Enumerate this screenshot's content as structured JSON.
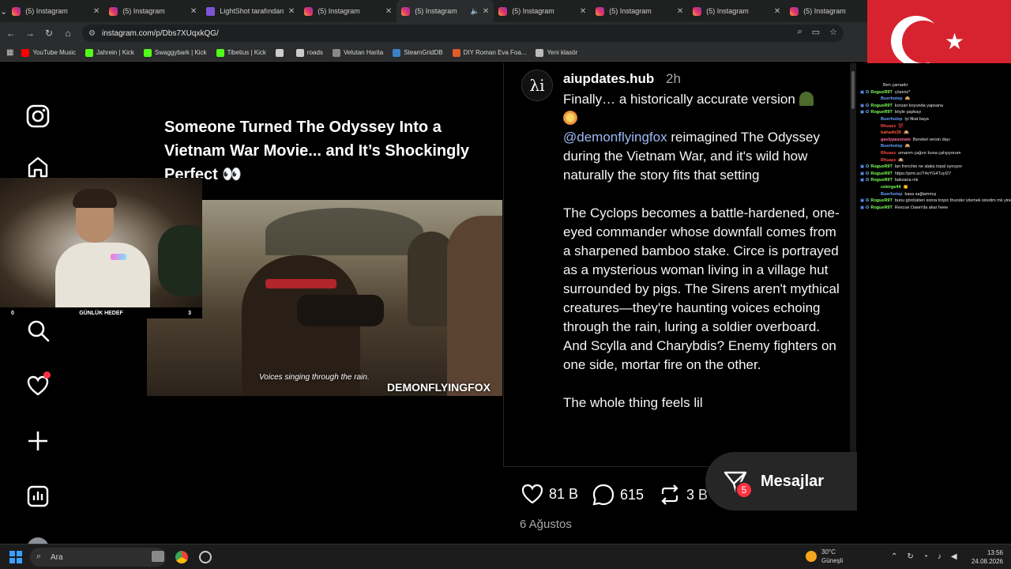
{
  "browser": {
    "tabs": [
      {
        "label": "(5) Instagram",
        "active": false
      },
      {
        "label": "(5) Instagram",
        "active": false
      },
      {
        "label": "LightShot tarafından",
        "active": false
      },
      {
        "label": "(5) Instagram",
        "active": false
      },
      {
        "label": "(5) Instagram",
        "active": true
      },
      {
        "label": "(5) Instagram",
        "active": false
      },
      {
        "label": "(5) Instagram",
        "active": false
      },
      {
        "label": "(5) Instagram",
        "active": false
      },
      {
        "label": "(5) Instagram",
        "active": false
      }
    ],
    "url": "instagram.com/p/Dbs7XUqxkQG/",
    "bookmarks": [
      {
        "label": "YouTube Music",
        "color": "#ff0000"
      },
      {
        "label": "Jahrein | Kick",
        "color": "#53fc18"
      },
      {
        "label": "Swaggybark | Kick",
        "color": "#53fc18"
      },
      {
        "label": "Tibetius | Kick",
        "color": "#53fc18"
      },
      {
        "label": "",
        "color": "#cccccc"
      },
      {
        "label": "roads",
        "color": "#cccccc"
      },
      {
        "label": "Velutan Harita",
        "color": "#888888"
      },
      {
        "label": "SteamGridDB",
        "color": "#3b82c4"
      },
      {
        "label": "DIY Roman Eva Foa...",
        "color": "#e05a2b"
      },
      {
        "label": "Yeni klasör",
        "color": "#bbbbbb"
      }
    ]
  },
  "rail": {
    "icons": [
      "instagram-logo-icon",
      "home-icon",
      "search-icon",
      "heart-icon",
      "create-icon",
      "insights-icon"
    ]
  },
  "overlay": {
    "goal_left": "0",
    "goal_label": "GÜNLÜK HEDEF",
    "goal_right": "3"
  },
  "media": {
    "headline": "Someone Turned The Odyssey Into a Vietnam War Movie... and It’s Shockingly Perfect 👀",
    "subtitle": "Voices singing through the rain.",
    "watermark": "DEMONFLYINGFOX"
  },
  "post": {
    "avatar_text": "λi",
    "username": "aiupdates.hub",
    "time": "2h",
    "line1": "Finally… a historically accurate version",
    "mention": "@demonflyingfox",
    "para1_rest": " reimagined The Odyssey during the Vietnam War, and it's wild how naturally the story fits that setting",
    "para2": "The Cyclops becomes a battle-hardened, one-eyed commander whose downfall comes from a sharpened bamboo stake. Circe is portrayed as a mysterious woman living in a village hut surrounded by pigs. The Sirens aren't mythical creatures—they're haunting voices echoing through the rain, luring a soldier overboard. And Scylla and Charybdis? Enemy fighters on one side, mortar fire on the other.",
    "para3": "The whole thing feels lil",
    "likes": "81 B",
    "comments": "615",
    "reposts": "3 B",
    "date": "6 Ağustos"
  },
  "messages": {
    "label": "Mesajlar",
    "badge": "5"
  },
  "chat": [
    {
      "name": "",
      "color": "#ffffff",
      "text": "Ben çarnadır",
      "indent": true
    },
    {
      "name": "RogueR9T",
      "color": "#7cff5a",
      "text": "çözeriz*",
      "indent": false
    },
    {
      "name": "Buerhotep",
      "color": "#6aa0ff",
      "text": "🙉",
      "indent": true
    },
    {
      "name": "RogueR9T",
      "color": "#7cff5a",
      "text": "korsan koyunda yapsana",
      "indent": false
    },
    {
      "name": "RogueR9T",
      "color": "#7cff5a",
      "text": "böyle şapkayı",
      "indent": false
    },
    {
      "name": "Buerhotep",
      "color": "#6aa0ff",
      "text": "iyi fikat baya",
      "indent": true
    },
    {
      "name": "Rhuazz",
      "color": "#ff4a4a",
      "text": "💯",
      "indent": true
    },
    {
      "name": "bahadir26",
      "color": "#ff5a3a",
      "text": "🙉",
      "indent": true
    },
    {
      "name": "gavlypasonale",
      "color": "#ff6a9a",
      "text": "Bereket versin dayı",
      "indent": true
    },
    {
      "name": "Buerhotep",
      "color": "#6aa0ff",
      "text": "🙉",
      "indent": true
    },
    {
      "name": "Rhuazz",
      "color": "#ff4a4a",
      "text": "umarım çağırır buna çalışıyorum",
      "indent": true
    },
    {
      "name": "Rhuazz",
      "color": "#ff4a4a",
      "text": "🙉",
      "indent": true
    },
    {
      "name": "RogueR9T",
      "color": "#7cff5a",
      "text": "lan frenchie ne alaka topal oynuyor",
      "indent": false
    },
    {
      "name": "RogueR9T",
      "color": "#7cff5a",
      "text": "https://prnt.sc/T4vYG4TuyI27",
      "indent": false
    },
    {
      "name": "RogueR9T",
      "color": "#7cff5a",
      "text": "baksana mk",
      "indent": false
    },
    {
      "name": "cekirge44",
      "color": "#7cff5a",
      "text": "👏",
      "indent": true
    },
    {
      "name": "Buerhotep",
      "color": "#6aa0ff",
      "text": "kasa sağlammış",
      "indent": true
    },
    {
      "name": "RogueR9T",
      "color": "#7cff5a",
      "text": "bunu gördükten sonra tropic thunder izlemek istedim mk yine izleyesim geldi",
      "indent": false
    },
    {
      "name": "RogueR9T",
      "color": "#7cff5a",
      "text": "Rescue Dawn'da akar heee",
      "indent": false
    }
  ],
  "taskbar": {
    "search": "Ara",
    "temp": "30°C",
    "weather": "Güneşli",
    "time": "13:56",
    "date": "24.08.2026"
  }
}
